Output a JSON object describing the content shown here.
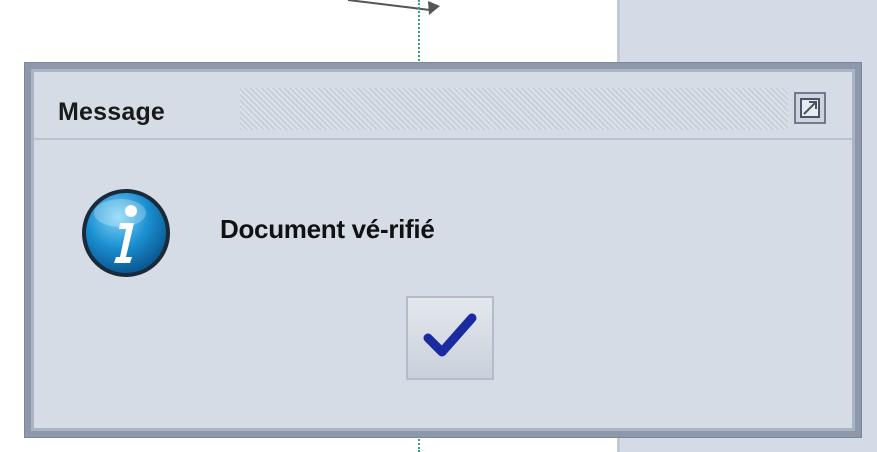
{
  "dialog": {
    "title": "Message",
    "message": "Document vé-rifié",
    "icon": "info-icon",
    "ok_button": {
      "icon": "checkmark-icon",
      "accessible_label": ""
    },
    "title_button_icon": "maximize-icon"
  },
  "colors": {
    "dialog_background": "#d6dce6",
    "dialog_frame": "#8d99ab",
    "info_icon_blue": "#1b8fd1",
    "checkmark": "#1b2aa0",
    "side_panel": "#d4dbe6",
    "guide_line": "#3aa07a"
  }
}
